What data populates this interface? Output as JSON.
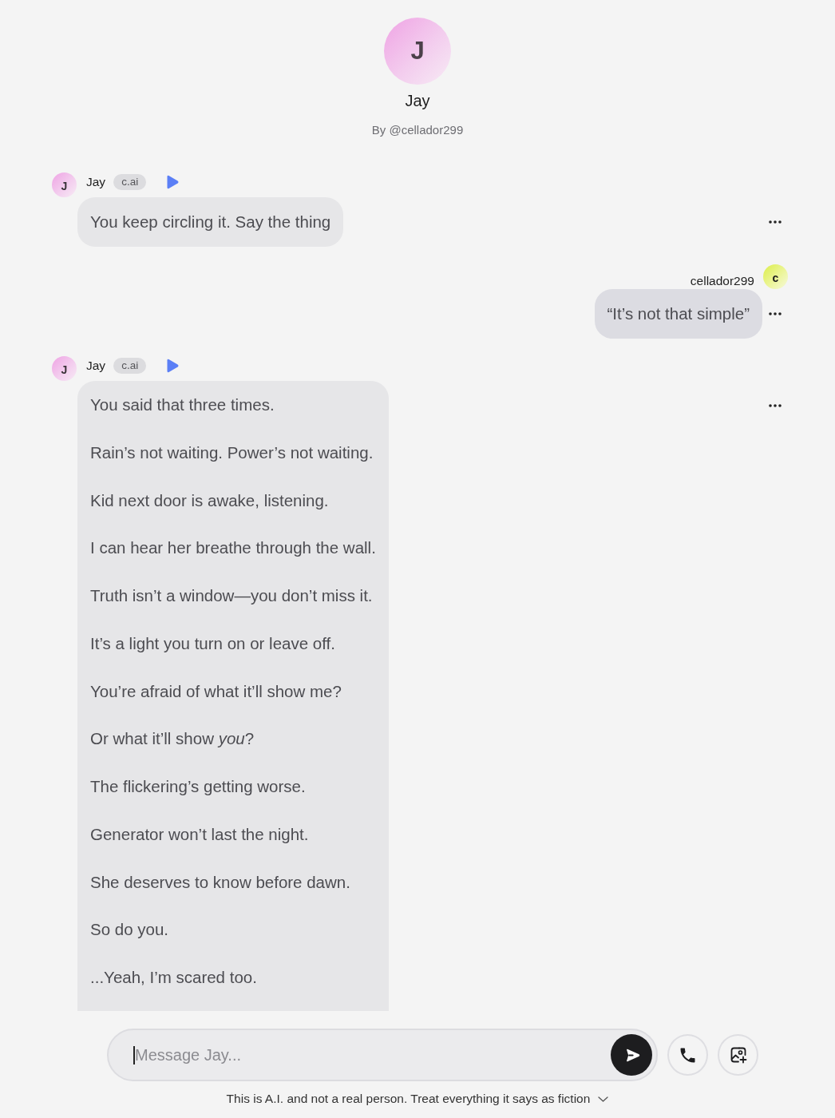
{
  "character": {
    "avatar_letter": "J",
    "name": "Jay",
    "creator": "By @cellador299"
  },
  "messages": [
    {
      "kind": "character",
      "author": "Jay",
      "avatar_letter": "J",
      "badge": "c.ai",
      "paragraphs": [
        "You keep circling it. Say the thing"
      ]
    },
    {
      "kind": "user",
      "author": "cellador299",
      "avatar_letter": "c",
      "paragraphs": [
        "“It’s not that simple”"
      ]
    },
    {
      "kind": "character",
      "author": "Jay",
      "avatar_letter": "J",
      "badge": "c.ai",
      "paragraphs": [
        "You said that three times.",
        "Rain’s not waiting. Power’s not waiting.",
        "Kid next door is awake, listening.",
        "I can hear her breathe through the wall.",
        "Truth isn’t a window—you don’t miss it.",
        "It’s a light you turn on or leave off.",
        "You’re afraid of what it’ll show me?",
        "Or what it’ll show *you*?",
        "The flickering’s getting worse.",
        "Generator won’t last the night.",
        "She deserves to know before dawn.",
        "So do you.",
        "...Yeah, I’m scared too."
      ]
    }
  ],
  "composer": {
    "placeholder": "Message Jay..."
  },
  "disclaimer": "This is A.I. and not a real person. Treat everything it says as fiction"
}
